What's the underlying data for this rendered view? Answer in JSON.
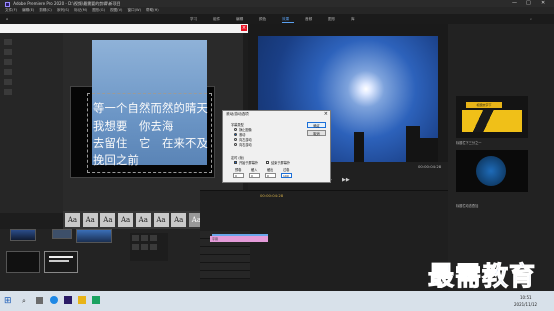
{
  "window": {
    "title": "Adobe Premiere Pro 2020 - D:\\视频\\最需要的剪辑\\新项目",
    "minimize": "—",
    "maximize": "□",
    "close": "✕"
  },
  "menu": [
    "文件(F)",
    "编辑(E)",
    "剪辑(C)",
    "序列(S)",
    "标记(M)",
    "图形(G)",
    "视图(V)",
    "窗口(W)",
    "帮助(H)"
  ],
  "workspaces": [
    {
      "label": "学习",
      "active": false
    },
    {
      "label": "组件",
      "active": false
    },
    {
      "label": "编辑",
      "active": false
    },
    {
      "label": "颜色",
      "active": false
    },
    {
      "label": "效果",
      "active": true
    },
    {
      "label": "音频",
      "active": false
    },
    {
      "label": "图形",
      "active": false
    },
    {
      "label": "库",
      "active": false
    }
  ],
  "legacy_title": {
    "lines": [
      "等一个自然而然的晴天",
      "我想要　你去海",
      "去留住　它　在来不及",
      "挽回之前"
    ],
    "style_swatches": [
      "Aa",
      "Aa",
      "Aa",
      "Aa",
      "Aa",
      "Aa",
      "Aa",
      "Aa",
      "Aa",
      "Aa"
    ]
  },
  "program": {
    "timecode_current": "00:00:04:28",
    "timecode_duration": "00:00:04:28"
  },
  "timeline": {
    "timecode": "00:00:04:28",
    "clip_label": "字幕"
  },
  "essential_graphics": {
    "items": [
      {
        "label": "标题栏下三分之一",
        "badge": "标题文字下"
      },
      {
        "label": "标题栏动态叠加"
      }
    ]
  },
  "dialog": {
    "title": "滚动/游动选项",
    "type_label": "字幕类型",
    "options": [
      {
        "label": "静止图像",
        "selected": false
      },
      {
        "label": "滚动",
        "selected": true
      },
      {
        "label": "向左游动",
        "selected": false
      },
      {
        "label": "向右游动",
        "selected": false
      }
    ],
    "timing_label": "定时 (帧)",
    "checks": [
      {
        "label": "开始于屏幕外",
        "checked": true
      },
      {
        "label": "结束于屏幕外",
        "checked": false
      }
    ],
    "field_labels": [
      "预卷",
      "缓入",
      "缓出",
      "过卷"
    ],
    "field_values": [
      "0",
      "0",
      "0",
      "100"
    ],
    "ok_label": "确定",
    "cancel_label": "取消"
  },
  "taskbar": {
    "time": "10:51",
    "date": "2021/11/12"
  },
  "watermark": {
    "text": "最需教育"
  },
  "colors": {
    "accent": "#2d8ceb",
    "pink_clip": "#e49bd9",
    "dialog_bg": "#f0f0f0",
    "watermark": "#2d63c8"
  }
}
